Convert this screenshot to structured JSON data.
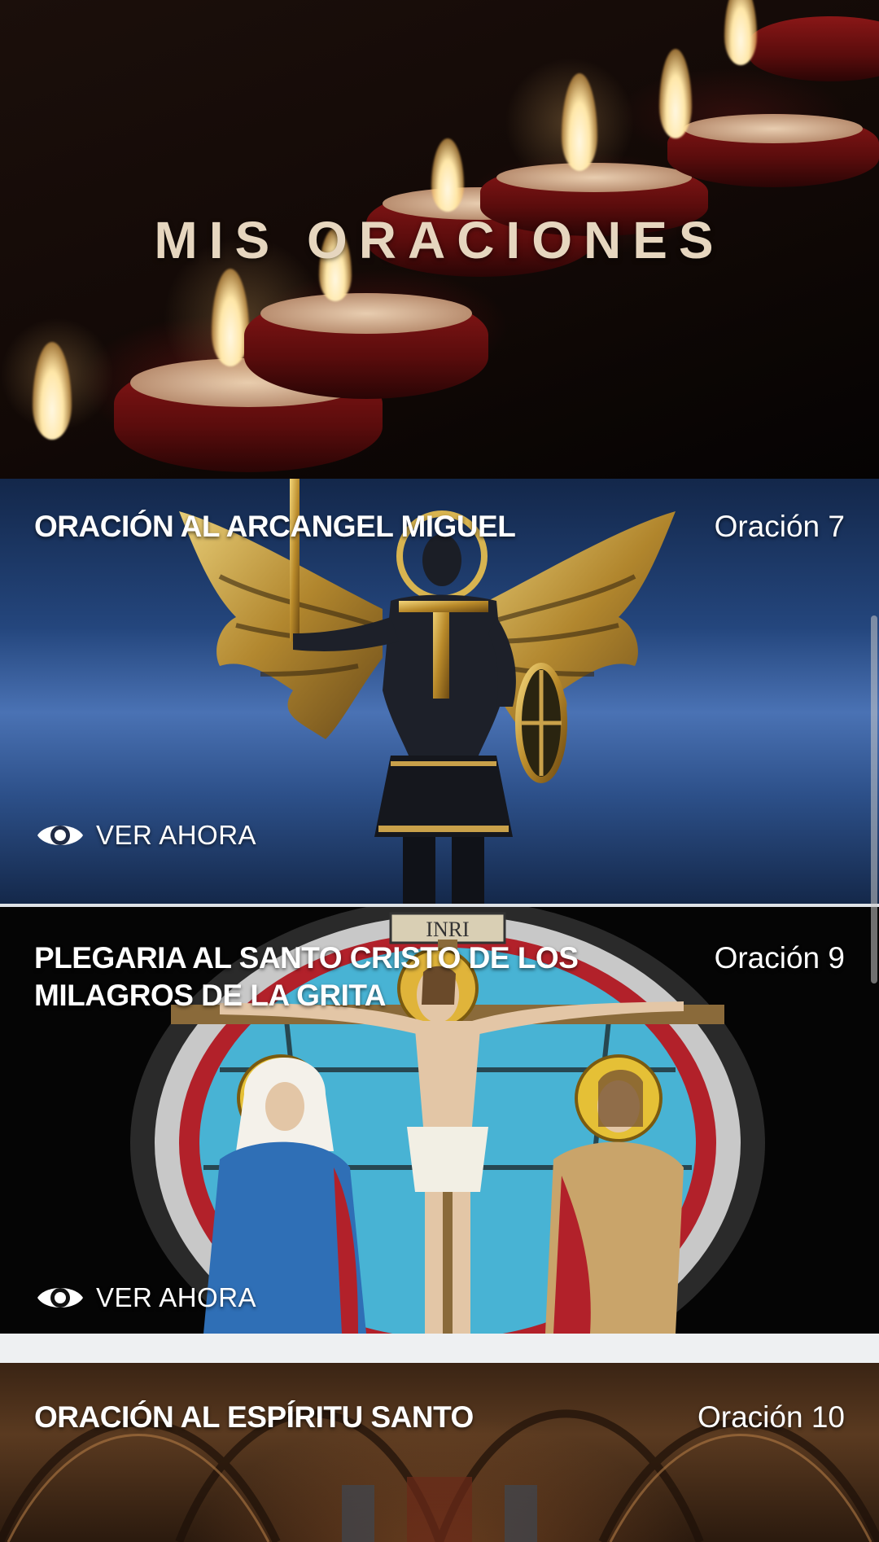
{
  "header": {
    "title": "MIS ORACIONES"
  },
  "cards": [
    {
      "title": "ORACIÓN AL ARCANGEL MIGUEL",
      "number": "Oración 7",
      "action": "VER AHORA",
      "image": "archangel-michael-statue"
    },
    {
      "title_line1": "PLEGARIA AL SANTO CRISTO DE LOS",
      "title_line2": "MILAGROS DE LA GRITA",
      "number": "Oración 9",
      "action": "VER AHORA",
      "image": "crucifixion-stained-glass",
      "glass_inscription": "INRI"
    },
    {
      "title": "ORACIÓN AL ESPÍRITU SANTO",
      "number": "Oración 10",
      "image": "cathedral-interior"
    }
  ],
  "colors": {
    "title_text": "#e6d6bf",
    "card_text": "#ffffff",
    "separator": "#eef0f2"
  },
  "icons": {
    "action": "eye-icon"
  }
}
